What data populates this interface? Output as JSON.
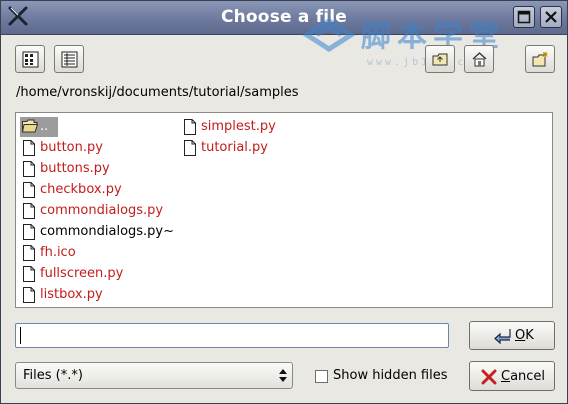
{
  "window": {
    "title": "Choose a file",
    "title_buttons": [
      {
        "name": "maximize",
        "icon": "maximize-icon"
      },
      {
        "name": "close",
        "icon": "close-icon"
      }
    ]
  },
  "watermark": {
    "text": "脚本学堂",
    "subtext": "www.jb100.com"
  },
  "toolbar": {
    "left_buttons": [
      {
        "name": "icon-view",
        "icon": "icon-view-icon"
      },
      {
        "name": "detail-view",
        "icon": "detail-view-icon"
      }
    ],
    "right_buttons": [
      {
        "name": "parent-folder",
        "icon": "parent-folder-icon"
      },
      {
        "name": "home",
        "icon": "home-icon"
      },
      {
        "name": "new-folder",
        "icon": "new-folder-icon"
      }
    ]
  },
  "path": "/home/vronskij/documents/tutorial/samples",
  "files": {
    "column1": [
      {
        "name": "..",
        "type": "folder",
        "selected": true
      },
      {
        "name": "button.py",
        "type": "py"
      },
      {
        "name": "buttons.py",
        "type": "py"
      },
      {
        "name": "checkbox.py",
        "type": "py"
      },
      {
        "name": "commondialogs.py",
        "type": "py"
      },
      {
        "name": "commondialogs.py~",
        "type": "plain"
      },
      {
        "name": "fh.ico",
        "type": "py"
      },
      {
        "name": "fullscreen.py",
        "type": "py"
      },
      {
        "name": "listbox.py",
        "type": "py"
      }
    ],
    "column2": [
      {
        "name": "simplest.py",
        "type": "py"
      },
      {
        "name": "tutorial.py",
        "type": "py"
      }
    ]
  },
  "filename_input": {
    "value": "",
    "placeholder": ""
  },
  "ok_button": {
    "label_first": "O",
    "label_rest": "K",
    "icon": "ok-arrow-icon"
  },
  "cancel_button": {
    "label_first": "C",
    "label_rest": "ancel",
    "icon": "cancel-x-icon"
  },
  "filter": {
    "selected": "Files (*.*)"
  },
  "show_hidden": {
    "label": "Show hidden files",
    "checked": false
  },
  "colors": {
    "title_bar": "#7381a5",
    "window_bg": "#e9e8e3",
    "py_file_text": "#c41c1c",
    "selection": "#9c9c9c",
    "watermark": "#3b84cf"
  }
}
